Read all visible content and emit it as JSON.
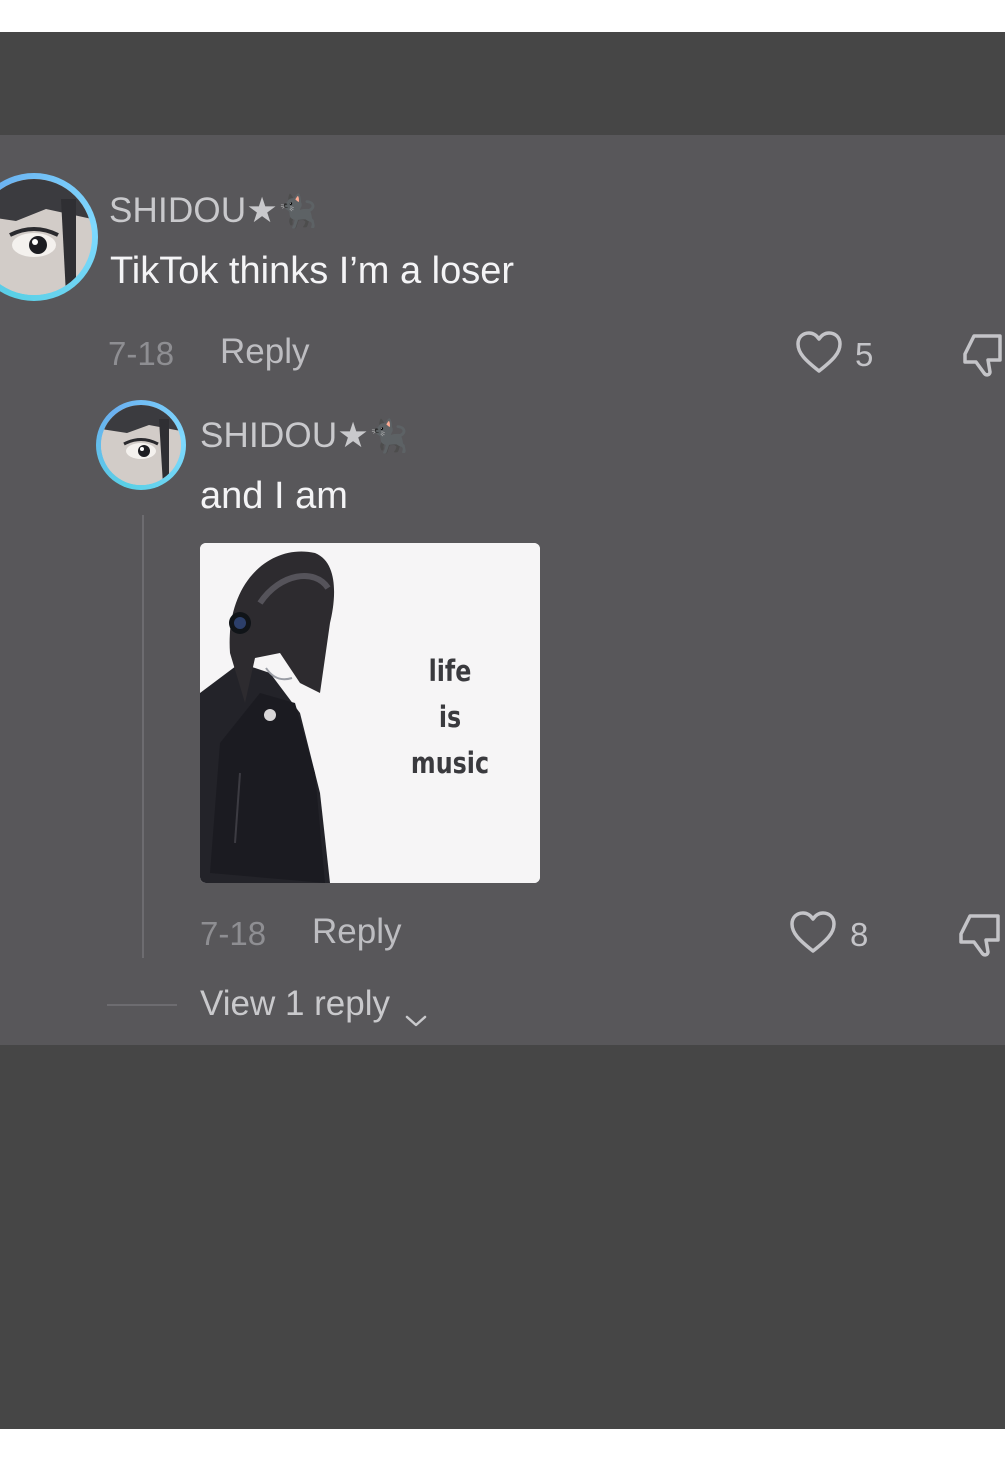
{
  "comment": {
    "username": "SHIDOU",
    "username_star": "★",
    "username_emoji": "🐈‍⬛",
    "text": "TikTok thinks I’m a loser",
    "date": "7-18",
    "reply_label": "Reply",
    "likes": "5",
    "icons": {
      "like": "heart-outline-icon",
      "dislike": "thumbs-down-icon"
    }
  },
  "reply": {
    "username": "SHIDOU",
    "username_star": "★",
    "username_emoji": "🐈‍⬛",
    "text": "and I am",
    "sticker": {
      "lines": [
        "life",
        "is",
        "music"
      ]
    },
    "date": "7-18",
    "reply_label": "Reply",
    "likes": "8",
    "icons": {
      "like": "heart-outline-icon",
      "dislike": "thumbs-down-icon"
    }
  },
  "view_replies": {
    "label": "View 1 reply",
    "icon": "chevron-down-icon"
  },
  "colors": {
    "panel": "#58575a",
    "frame": "#464646",
    "avatar_ring": "#5ad0e6"
  }
}
